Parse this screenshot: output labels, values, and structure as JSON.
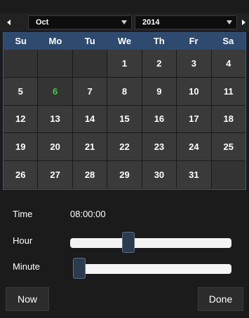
{
  "header": {
    "month": "Oct",
    "year": "2014"
  },
  "weekdays": [
    "Su",
    "Mo",
    "Tu",
    "We",
    "Th",
    "Fr",
    "Sa"
  ],
  "weeks": [
    [
      "",
      "",
      "",
      "1",
      "2",
      "3",
      "4"
    ],
    [
      "5",
      "6",
      "7",
      "8",
      "9",
      "10",
      "11"
    ],
    [
      "12",
      "13",
      "14",
      "15",
      "16",
      "17",
      "18"
    ],
    [
      "19",
      "20",
      "21",
      "22",
      "23",
      "24",
      "25"
    ],
    [
      "26",
      "27",
      "28",
      "29",
      "30",
      "31",
      ""
    ]
  ],
  "today": "6",
  "time": {
    "label": "Time",
    "value": "08:00:00",
    "hour_label": "Hour",
    "minute_label": "Minute",
    "hour_fraction": 0.35,
    "minute_fraction": 0.0
  },
  "buttons": {
    "now": "Now",
    "done": "Done"
  },
  "colors": {
    "today": "#39d439",
    "header_bar": "#2e4a6e",
    "border": "#36598a"
  }
}
